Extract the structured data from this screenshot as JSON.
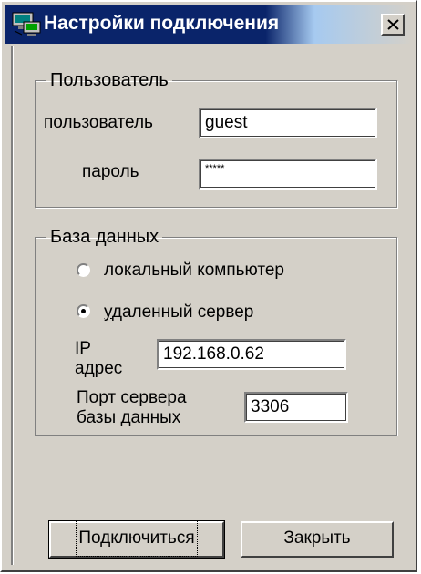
{
  "window": {
    "title": "Настройки подключения",
    "icon": "network-computer-icon",
    "close_glyph": "close-icon"
  },
  "user_group": {
    "legend": "Пользователь",
    "user_label": "пользователь",
    "user_value": "guest",
    "password_label": "пароль",
    "password_value": "*****"
  },
  "db_group": {
    "legend": "База данных",
    "radio_local": {
      "label": "локальный компьютер",
      "checked": false
    },
    "radio_remote": {
      "label": "удаленный сервер",
      "checked": true
    },
    "ip_label_line1": "IP",
    "ip_label_line2": "адрес",
    "ip_value": "192.168.0.62",
    "port_label_line1": "Порт сервера",
    "port_label_line2": "базы данных",
    "port_value": "3306"
  },
  "buttons": {
    "connect": "Подключиться",
    "close": "Закрыть"
  },
  "colors": {
    "title_active": "#0a246a",
    "title_fade": "#a6caf0",
    "face": "#d4d0c8"
  }
}
